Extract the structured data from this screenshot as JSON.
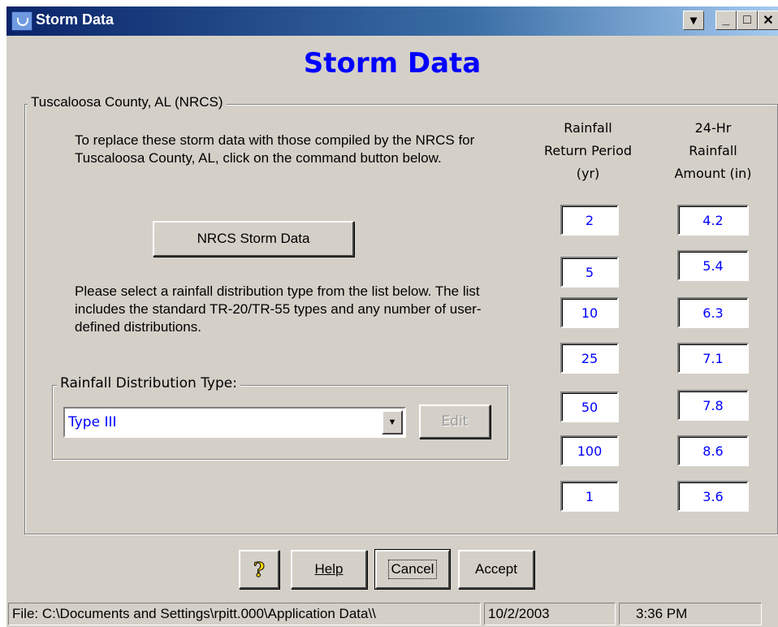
{
  "window": {
    "title": "Storm Data"
  },
  "header": {
    "title": "Storm Data"
  },
  "location_group": {
    "label": "Tuscaloosa County, AL  (NRCS)",
    "instructions": "To replace these storm data with those compiled by the NRCS for Tuscaloosa County, AL, click on the command button below.",
    "nrcs_button": "NRCS Storm Data",
    "distribution_instructions": "Please select a rainfall distribution type from the list below.  The list includes the standard TR-20/TR-55 types and any number of user-defined distributions."
  },
  "distribution_group": {
    "label": "Rainfall Distribution Type:",
    "selected": "Type III",
    "edit_button": "Edit"
  },
  "table": {
    "col1_header": [
      "Rainfall",
      "Return Period",
      "(yr)"
    ],
    "col2_header": [
      "24-Hr",
      "Rainfall",
      "Amount (in)"
    ],
    "rows": [
      {
        "period": "2",
        "amount": "4.2"
      },
      {
        "period": "5",
        "amount": "5.4"
      },
      {
        "period": "10",
        "amount": "6.3"
      },
      {
        "period": "25",
        "amount": "7.1"
      },
      {
        "period": "50",
        "amount": "7.8"
      },
      {
        "period": "100",
        "amount": "8.6"
      },
      {
        "period": "1",
        "amount": "3.6"
      }
    ]
  },
  "buttons": {
    "help_icon": "?",
    "help": "Help",
    "cancel": "Cancel",
    "accept": "Accept"
  },
  "statusbar": {
    "file": "File: C:\\Documents and Settings\\rpitt.000\\Application Data\\\\",
    "date": "10/2/2003",
    "time": "3:36 PM"
  },
  "icons": [
    "app-icon",
    "system-menu-icon",
    "minimize-icon",
    "maximize-icon",
    "close-icon",
    "dropdown-arrow-icon",
    "help-question-icon"
  ],
  "colors": {
    "title_gradient_start": "#0a246a",
    "dialog_face": "#d4d0c8",
    "accent_text": "#0000ff"
  }
}
